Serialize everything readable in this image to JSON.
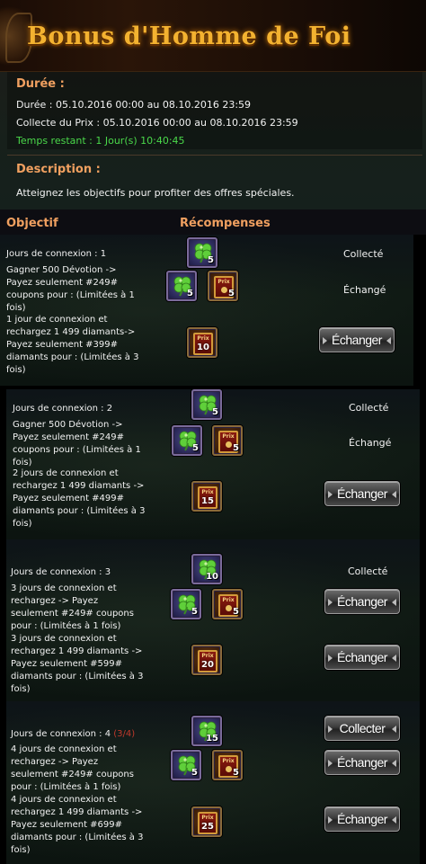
{
  "header": {
    "title": "Bonus d'Homme de Foi"
  },
  "duration": {
    "title": "Durée :",
    "line1": "Durée : 05.10.2016 00:00 au 08.10.2016 23:59",
    "line2": "Collecte du Prix : 05.10.2016 00:00 au 08.10.2016 23:59",
    "remaining": "Temps restant : 1 Jour(s)  10:40:45"
  },
  "description": {
    "title": "Description :",
    "text": "Atteignez les objectifs pour profiter des offres spéciales."
  },
  "table_headers": {
    "objective": "Objectif",
    "rewards": "Récompenses"
  },
  "blocks": [
    {
      "day": {
        "lines": [
          "Jours de connexion : 1"
        ],
        "clover_qty": "5",
        "status": "Collecté"
      },
      "devotion": {
        "lines": [
          "Gagner 500 Dévotion  ->",
          "Payez seulement #249#",
          "coupons pour :  (Limitées à 1",
          "fois)"
        ],
        "clover_qty": "5",
        "prix_qty": "5",
        "status": "Échangé"
      },
      "recharge": {
        "lines": [
          "1 jour de connexion et",
          "rechargez 1 499 diamants->",
          "Payez seulement #399#",
          "diamants pour :  (Limitées à 3",
          "fois)"
        ],
        "prix_qty": "10",
        "button": "Échanger"
      }
    },
    {
      "day": {
        "lines": [
          "Jours de connexion : 2"
        ],
        "clover_qty": "5",
        "status": "Collecté"
      },
      "devotion": {
        "lines": [
          "Gagner 500 Dévotion ->",
          "Payez seulement #249#",
          "coupons pour :  (Limitées à 1",
          "fois)"
        ],
        "clover_qty": "5",
        "prix_qty": "5",
        "status": "Échangé"
      },
      "recharge": {
        "lines": [
          "2 jours de connexion et",
          "rechargez 1 499 diamants ->",
          "Payez seulement #499#",
          "diamants pour :  (Limitées à 3",
          "fois)"
        ],
        "prix_qty": "15",
        "button": "Échanger"
      }
    },
    {
      "day": {
        "lines": [
          "Jours de connexion : 3"
        ],
        "clover_qty": "10",
        "status": "Collecté"
      },
      "devotion": {
        "lines": [
          "3 jours de connexion et",
          "rechargez -> Payez",
          "seulement #249# coupons",
          "pour :  (Limitées à 1 fois)"
        ],
        "clover_qty": "5",
        "prix_qty": "5",
        "button": "Échanger"
      },
      "recharge": {
        "lines": [
          "3 jours de connexion et",
          "rechargez 1 499 diamants ->",
          "Payez seulement #599#",
          "diamants pour :  (Limitées à 3",
          "fois)"
        ],
        "prix_qty": "20",
        "button": "Échanger"
      }
    },
    {
      "day": {
        "lines": [
          "Jours de connexion : 4"
        ],
        "count": "(3/4)",
        "clover_qty": "15",
        "button": "Collecter"
      },
      "devotion": {
        "lines": [
          "4 jours de connexion et",
          "rechargez -> Payez",
          "seulement #249# coupons",
          "pour :  (Limitées à 1 fois)"
        ],
        "clover_qty": "5",
        "prix_qty": "5",
        "button": "Échanger"
      },
      "recharge": {
        "lines": [
          "4 jours de connexion et",
          "rechargez 1 499 diamants ->",
          "Payez seulement #699#",
          "diamants pour :  (Limitées à 3",
          "fois)"
        ],
        "prix_qty": "25",
        "button": "Échanger"
      }
    }
  ],
  "icons": {
    "clover": "four-leaf-clover-icon",
    "prix": "prix-ticket-icon"
  },
  "prix_label": "Prix",
  "colors": {
    "title": "#f3b230",
    "section": "#f0a060",
    "remaining": "#4ad84a",
    "count": "#c0392b"
  }
}
